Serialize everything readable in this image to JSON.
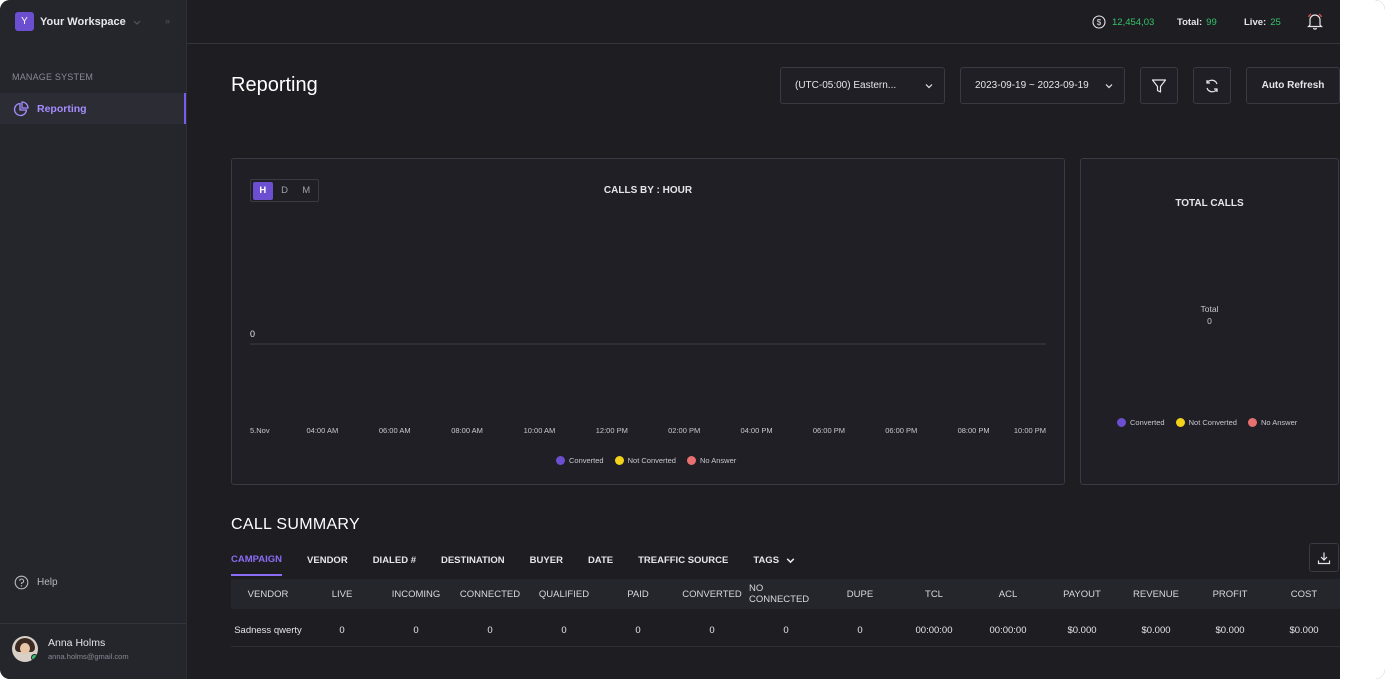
{
  "sidebar": {
    "workspace_initial": "Y",
    "workspace_name": "Your Workspace",
    "section_label": "MANAGE SYSTEM",
    "nav_reporting": "Reporting",
    "help": "Help",
    "user_name": "Anna Holms",
    "user_email": "anna.holms@gmail.com"
  },
  "topbar": {
    "balance": "12,454,03",
    "total_label": "Total:",
    "total_value": "99",
    "live_label": "Live:",
    "live_value": "25"
  },
  "header": {
    "title": "Reporting",
    "timezone": "(UTC-05:00) Eastern...",
    "date_range": "2023-09-19 ~ 2023-09-19",
    "auto_refresh": "Auto Refresh"
  },
  "hour_chart": {
    "toggle": [
      "H",
      "D",
      "M"
    ],
    "active_toggle": "H",
    "title": "CALLS BY : HOUR",
    "y_zero": "0",
    "x_ticks": [
      "5.Nov",
      "04:00 AM",
      "06:00 AM",
      "08:00 AM",
      "10:00 AM",
      "12:00 PM",
      "02:00 PM",
      "04:00 PM",
      "06:00 PM",
      "06:00 PM",
      "08:00 PM",
      "10:00 PM"
    ],
    "legend": [
      {
        "label": "Converted",
        "color": "#6b4fd0"
      },
      {
        "label": "Not Converted",
        "color": "#f2d21b"
      },
      {
        "label": "No Answer",
        "color": "#e87070"
      }
    ]
  },
  "total_calls": {
    "title": "TOTAL CALLS",
    "center_label": "Total",
    "center_value": "0",
    "legend": [
      {
        "label": "Converted",
        "color": "#6b4fd0"
      },
      {
        "label": "Not Converted",
        "color": "#f2d21b"
      },
      {
        "label": "No Answer",
        "color": "#e87070"
      }
    ]
  },
  "summary": {
    "title": "CALL SUMMARY",
    "tabs": [
      "CAMPAIGN",
      "VENDOR",
      "DIALED #",
      "DESTINATION",
      "BUYER",
      "DATE",
      "TREAFFIC SOURCE",
      "TAGS"
    ],
    "active_tab": "CAMPAIGN",
    "columns": [
      "VENDOR",
      "LIVE",
      "INCOMING",
      "CONNECTED",
      "QUALIFIED",
      "PAID",
      "CONVERTED",
      "NO CONNECTED",
      "DUPE",
      "TCL",
      "ACL",
      "PAYOUT",
      "REVENUE",
      "PROFIT",
      "COST"
    ],
    "rows": [
      [
        "Sadness qwerty",
        "0",
        "0",
        "0",
        "0",
        "0",
        "0",
        "0",
        "0",
        "00:00:00",
        "00:00:00",
        "$0.000",
        "$0.000",
        "$0.000",
        "$0.000"
      ]
    ]
  },
  "chart_data": {
    "type": "line",
    "title": "CALLS BY : HOUR",
    "categories": [
      "5.Nov",
      "04:00 AM",
      "06:00 AM",
      "08:00 AM",
      "10:00 AM",
      "12:00 PM",
      "02:00 PM",
      "04:00 PM",
      "06:00 PM",
      "06:00 PM",
      "08:00 PM",
      "10:00 PM"
    ],
    "series": [
      {
        "name": "Converted",
        "values": [
          0,
          0,
          0,
          0,
          0,
          0,
          0,
          0,
          0,
          0,
          0,
          0
        ]
      },
      {
        "name": "Not Converted",
        "values": [
          0,
          0,
          0,
          0,
          0,
          0,
          0,
          0,
          0,
          0,
          0,
          0
        ]
      },
      {
        "name": "No Answer",
        "values": [
          0,
          0,
          0,
          0,
          0,
          0,
          0,
          0,
          0,
          0,
          0,
          0
        ]
      }
    ],
    "legend_position": "bottom"
  }
}
